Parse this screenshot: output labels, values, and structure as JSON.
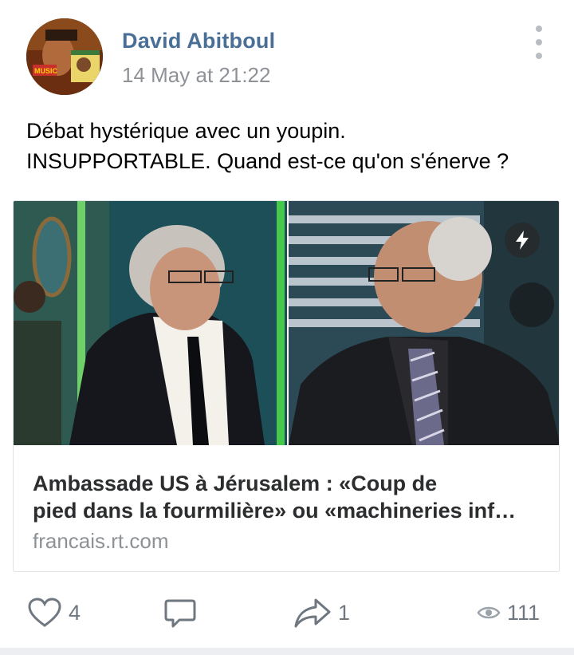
{
  "post": {
    "author": "David Abitboul",
    "timestamp": "14 May at 21:22",
    "text_lines": [
      "Débat hystérique avec un youpin.",
      "INSUPPORTABLE. Quand est-ce qu'on s'énerve ?"
    ]
  },
  "avatar_text": "MUSIC",
  "link_card": {
    "title_lines": [
      "Ambassade US à Jérusalem : «Coup de",
      "pied dans la fourmilière» ou «machineries inf…"
    ],
    "domain": "francais.rt.com",
    "badge_icon": "lightning-icon"
  },
  "actions": {
    "likes": "4",
    "shares": "1",
    "views": "111"
  },
  "colors": {
    "author": "#4a6f97",
    "muted": "#8e9296",
    "icon": "#6f7780"
  }
}
